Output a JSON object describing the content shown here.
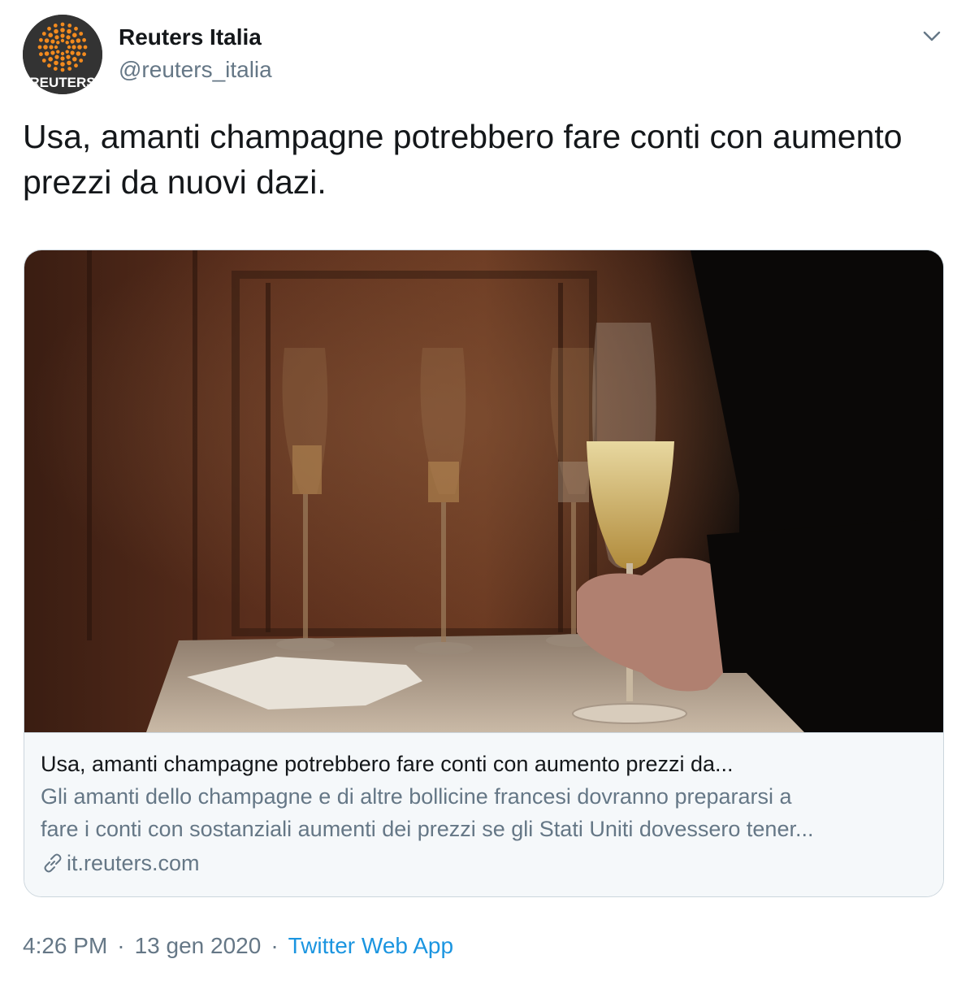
{
  "tweet": {
    "author_name": "Reuters Italia",
    "author_handle": "@reuters_italia",
    "avatar_logo_text": "REUTERS",
    "text": "Usa, amanti champagne potrebbero fare conti con aumento prezzi da nuovi dazi.",
    "time": "4:26 PM",
    "date": "13 gen 2020",
    "separator": "·",
    "source": "Twitter Web App",
    "menu_icon": "chevron-down-icon"
  },
  "card": {
    "image_description": "champagne-flutes-photo",
    "title": "Usa, amanti champagne potrebbero fare conti con aumento prezzi da...",
    "description_line1": "Gli amanti dello champagne e di altre bollicine francesi dovranno prepararsi a",
    "description_line2": "fare i conti con sostanziali aumenti dei prezzi se gli Stati Uniti dovessero tener...",
    "domain": "it.reuters.com",
    "domain_icon": "link-icon"
  },
  "colors": {
    "text_primary": "#14171a",
    "text_secondary": "#657786",
    "link": "#1b95e0",
    "border": "#ccd6dd",
    "card_bg": "#f5f8fa",
    "logo_orange": "#f28a1e"
  }
}
